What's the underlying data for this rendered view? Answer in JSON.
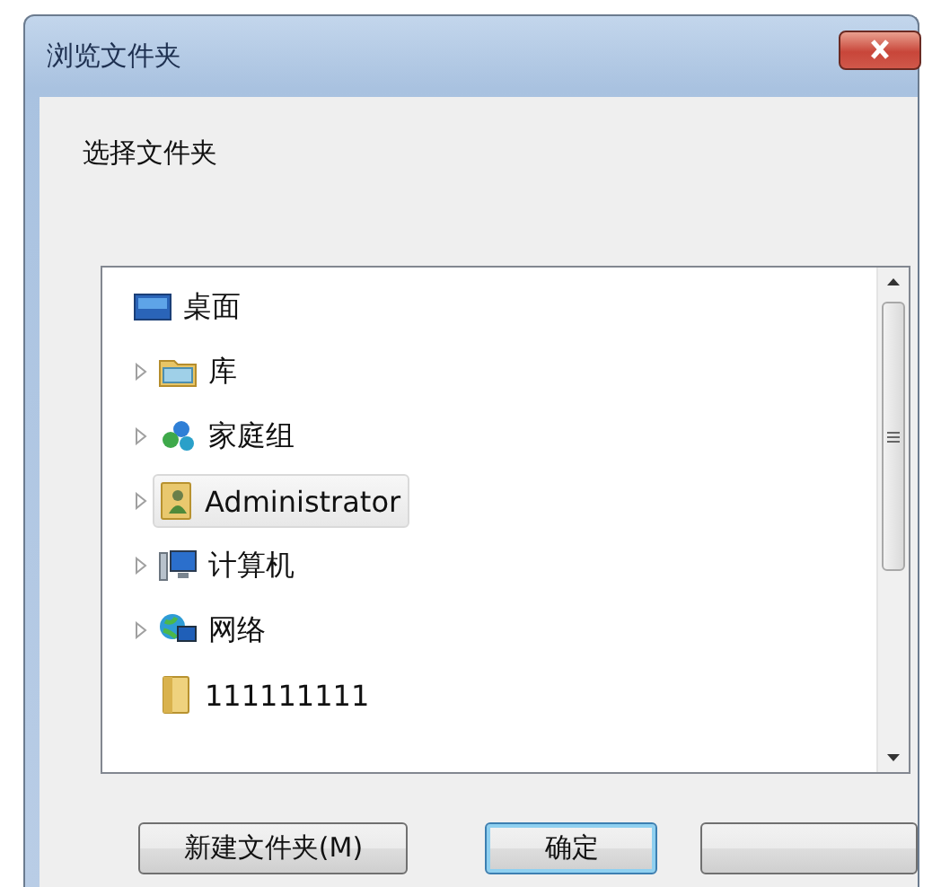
{
  "window": {
    "title": "浏览文件夹"
  },
  "prompt": "选择文件夹",
  "tree": [
    {
      "label": "桌面",
      "kind": "desktop",
      "selected": false,
      "children": [
        {
          "label": "库",
          "kind": "library",
          "selected": false,
          "expandable": true
        },
        {
          "label": "家庭组",
          "kind": "homegroup",
          "selected": false,
          "expandable": true
        },
        {
          "label": "Administrator",
          "kind": "user",
          "selected": true,
          "expandable": true
        },
        {
          "label": "计算机",
          "kind": "computer",
          "selected": false,
          "expandable": true
        },
        {
          "label": "网络",
          "kind": "network",
          "selected": false,
          "expandable": true
        },
        {
          "label": "111111111",
          "kind": "folder",
          "selected": false,
          "expandable": false
        }
      ]
    }
  ],
  "buttons": [
    {
      "label": "新建文件夹(M)",
      "focused": false
    },
    {
      "label": "确定",
      "focused": true
    },
    {
      "focused": false
    }
  ]
}
